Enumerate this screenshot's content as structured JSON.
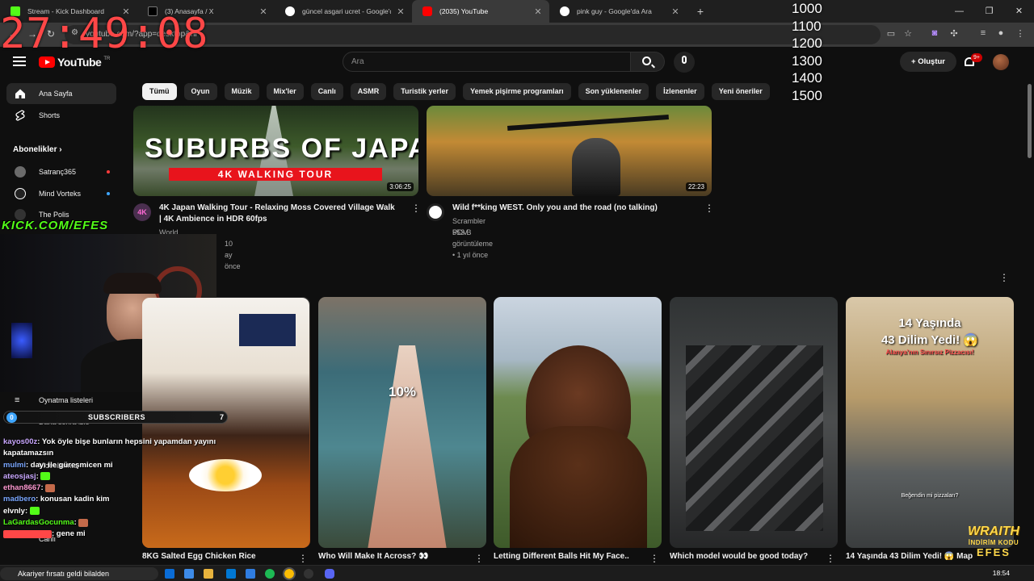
{
  "browser": {
    "tabs": [
      {
        "title": "Stream - Kick Dashboard",
        "color": "#53fc18",
        "active": false
      },
      {
        "title": "(3) Anasayfa / X",
        "color": "#000000",
        "active": false
      },
      {
        "title": "güncel asgari ucret - Google'da Ara",
        "color": "#4285f4",
        "active": false
      },
      {
        "title": "(2035) YouTube",
        "color": "#ff0000",
        "active": true
      },
      {
        "title": "pink guy - Google'da Ara",
        "color": "#4285f4",
        "active": false
      }
    ],
    "new_tab": "+",
    "address": "youtube.com/?app=desktop&hl",
    "window_controls": [
      "—",
      "❐",
      "✕"
    ]
  },
  "youtube": {
    "logo_text": "YouTube",
    "logo_region": "TR",
    "search_placeholder": "Ara",
    "create_label": "Oluştur",
    "notification_count": "9+",
    "chips": [
      "Tümü",
      "Oyun",
      "Müzik",
      "Mix'ler",
      "Canlı",
      "ASMR",
      "Turistik yerler",
      "Yemek pişirme programları",
      "Son yüklenenler",
      "İzlenenler",
      "Yeni öneriler"
    ],
    "sidebar": {
      "home": "Ana Sayfa",
      "shorts": "Shorts",
      "subscriptions_header": "Abonelikler",
      "subscriptions": [
        "Satranç365",
        "Mind Vorteks",
        "The Polis"
      ],
      "lower": [
        "Oynatma listeleri",
        "Daha sonra izle",
        "Videolarınız",
        "Canlı"
      ]
    },
    "videos": [
      {
        "title_l1": "4K Japan Walking Tour - Relaxing Moss Covered Village Walk",
        "title_l2": "| 4K Ambience in HDR 60fps",
        "channel": "World Wanderings: 4K Walking Tours",
        "age": "10 ay önce",
        "duration": "3:06:25",
        "thumb_text": "SUBURBS OF JAPAN",
        "thumb_sub": "4K WALKING TOUR",
        "avatar_text": "4K"
      },
      {
        "title_l1": "Wild f**king WEST. Only you and the road (no talking)",
        "channel": "Scrambler POV",
        "views": "553 B görüntüleme",
        "age": "1 yıl önce",
        "duration": "22:23"
      }
    ],
    "shorts": [
      {
        "title": "8KG Salted Egg Chicken Rice"
      },
      {
        "title": "Who Will Make It Across? 👀",
        "thumb_text": "10%"
      },
      {
        "title": "Letting Different Balls Hit My Face.."
      },
      {
        "title": "Which model would be good today?"
      },
      {
        "title": "14 Yaşında 43 Dilim Yedi! 😱 Map",
        "thumb_l1": "14 Yaşında",
        "thumb_l2": "43 Dilim Yedi! 😱",
        "thumb_l3": "Alanya'nın Sınırsız Pizzacısı!",
        "thumb_l4": "Beğendin mi pizzaları?"
      }
    ]
  },
  "overlay": {
    "timer": "27:49:08",
    "goals": [
      "1000",
      "1100",
      "1200",
      "1300",
      "1400",
      "1500"
    ],
    "kick": "KICK.COM/EFES",
    "subscribers_label": "SUBSCRIBERS",
    "subscribers_left": "0",
    "subscribers_right": "7",
    "chat": [
      {
        "user": "kayos00z",
        "msg": ": Yok öyle bişe bunların hepsini yapamdan yayını",
        "color": "#c9a7ff"
      },
      {
        "user": "",
        "msg": "kapatamazsın",
        "color": "#ffffff"
      },
      {
        "user": "mulmi",
        "msg": ": dayı ile güreşmicen mi",
        "color": "#7aa7ff"
      },
      {
        "user": "ateosjasj",
        "msg": ":",
        "color": "#c9a7ff"
      },
      {
        "user": "ethan8667",
        "msg": ":",
        "color": "#ff9ad1"
      },
      {
        "user": "madbero",
        "msg": ": konusan kadin kim",
        "color": "#7aa7ff"
      },
      {
        "user": "elvnly",
        "msg": ":",
        "color": "#ffffff"
      },
      {
        "user": "LaGardasGocunma",
        "msg": ":",
        "color": "#53fc18"
      },
      {
        "user": "",
        "msg": ": gene mi",
        "color": "#ff4747"
      }
    ],
    "sponsor_l1": "WRAITH",
    "sponsor_l2": "İNDİRİM KODU",
    "sponsor_l3": "EFES"
  },
  "taskbar": {
    "search_text": "Akariyer fırsatı geldi bilalden",
    "clock": "18:54"
  }
}
